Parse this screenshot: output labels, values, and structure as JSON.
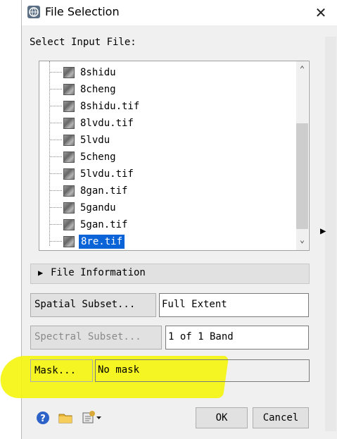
{
  "window": {
    "title": "File Selection",
    "close_symbol": "✕"
  },
  "select_label": "Select Input File:",
  "files": [
    {
      "name": "8shidu",
      "selected": false
    },
    {
      "name": "8cheng",
      "selected": false
    },
    {
      "name": "8shidu.tif",
      "selected": false
    },
    {
      "name": "8lvdu.tif",
      "selected": false
    },
    {
      "name": "5lvdu",
      "selected": false
    },
    {
      "name": "5cheng",
      "selected": false
    },
    {
      "name": "5lvdu.tif",
      "selected": false
    },
    {
      "name": "8gan.tif",
      "selected": false
    },
    {
      "name": "5gandu",
      "selected": false
    },
    {
      "name": "5gan.tif",
      "selected": false
    },
    {
      "name": "8re.tif",
      "selected": true
    }
  ],
  "scroll": {
    "up": "⌃",
    "down": "⌄"
  },
  "file_info": {
    "arrow": "▶",
    "label": "File Information"
  },
  "spatial": {
    "button": "Spatial Subset...",
    "value": "Full Extent"
  },
  "spectral": {
    "button": "Spectral Subset...",
    "value": "1 of 1 Band"
  },
  "mask": {
    "button": "Mask...",
    "value": "No mask"
  },
  "actions": {
    "ok": "OK",
    "cancel": "Cancel"
  },
  "icons": [
    "help-icon",
    "open-folder-icon",
    "options-menu-icon"
  ],
  "colors": {
    "selection": "#0a64d8",
    "highlight": "#f5f50c"
  }
}
